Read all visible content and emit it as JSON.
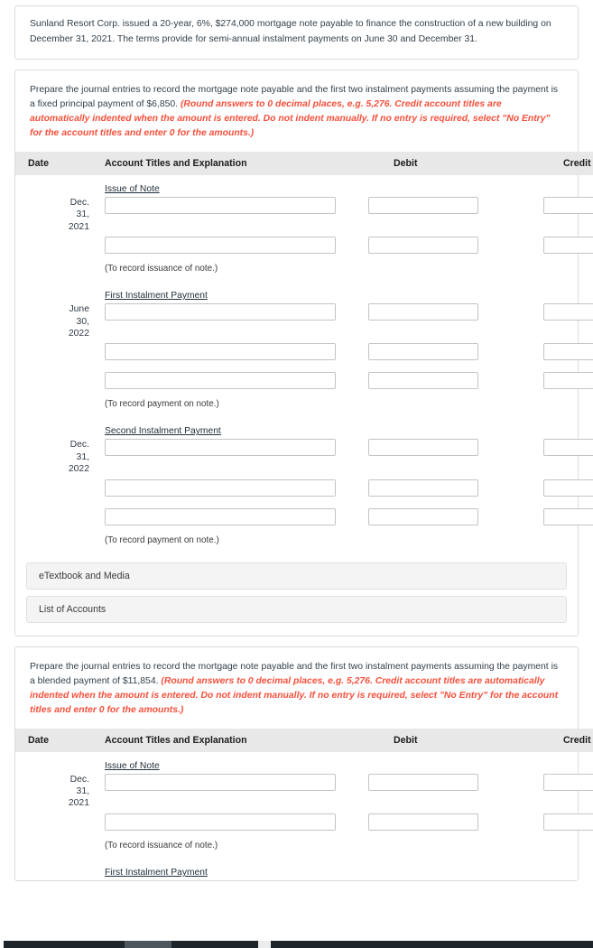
{
  "intro": {
    "text": "Sunland Resort Corp. issued a 20-year, 6%, $274,000 mortgage note payable to finance the construction of a new building on December 31, 2021. The terms provide for semi-annual instalment payments on June 30 and December 31."
  },
  "table_headers": {
    "date": "Date",
    "account": "Account Titles and Explanation",
    "debit": "Debit",
    "credit": "Credit"
  },
  "sections": {
    "issue_of_note": "Issue of Note",
    "first_instalment": "First Instalment Payment",
    "second_instalment": "Second Instalment Payment"
  },
  "captions": {
    "issuance": "(To record issuance of note.)",
    "payment": "(To record payment on note.)"
  },
  "dates": {
    "dec31_2021": "Dec.\n31,\n2021",
    "jun30_2022": "June\n30,\n2022",
    "dec31_2022": "Dec.\n31,\n2022"
  },
  "part_a": {
    "instruction_plain": "Prepare the journal entries to record the mortgage note payable and the first two instalment payments assuming the payment is a fixed principal payment of $6,850. ",
    "instruction_hint": "(Round answers to 0 decimal places, e.g. 5,276. Credit account titles are automatically indented when the amount is entered. Do not indent manually. If no entry is required, select \"No Entry\" for the account titles and enter 0 for the amounts.)"
  },
  "part_b": {
    "instruction_plain": "Prepare the journal entries to record the mortgage note payable and the first two instalment payments assuming the payment is a blended payment of $11,854. ",
    "instruction_hint": "(Round answers to 0 decimal places, e.g. 5,276. Credit account titles are automatically indented when the amount is entered. Do not indent manually. If no entry is required, select \"No Entry\" for the account titles and enter 0 for the amounts.)"
  },
  "field_values": {
    "empty": ""
  },
  "panels": {
    "etextbook": "eTextbook and Media",
    "list_of_accounts": "List of Accounts"
  },
  "colors": {
    "hint_red": "#f5503c",
    "header_gray": "#e8e8e8",
    "panel_gray": "#f4f4f4",
    "card_border": "#dcdcdc",
    "taskbar_dark": "#1e262b"
  }
}
